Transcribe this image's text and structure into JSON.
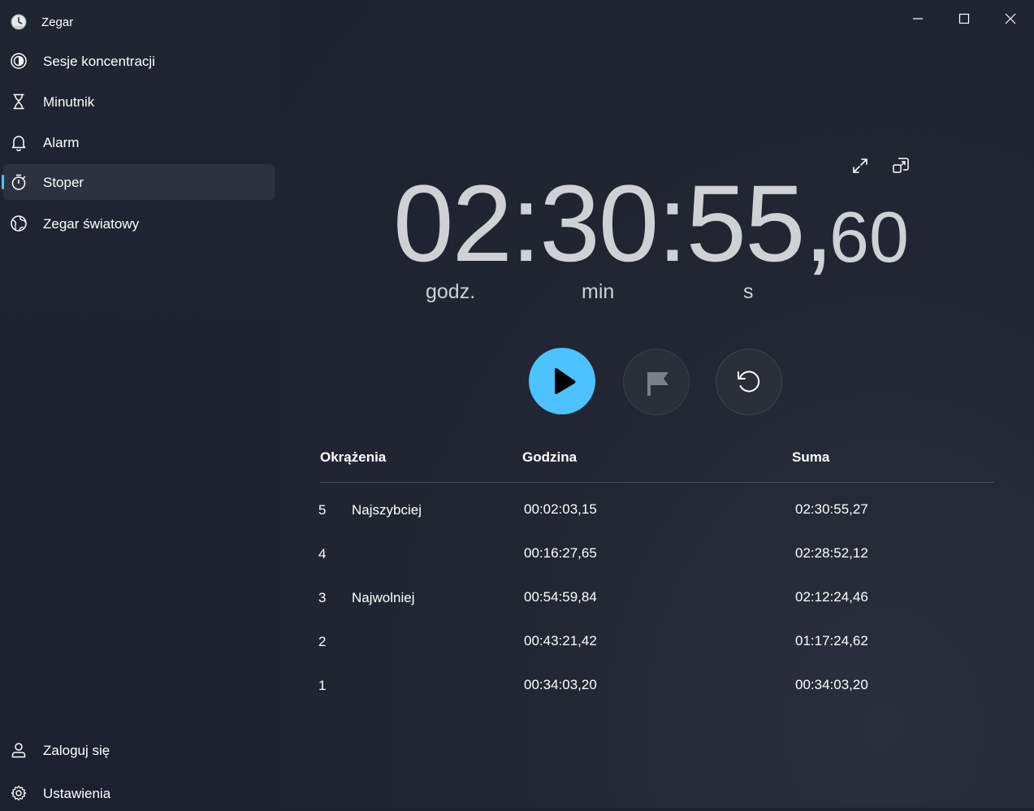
{
  "app": {
    "title": "Zegar"
  },
  "window_controls": {
    "minimize": "minimize-icon",
    "maximize": "maximize-icon",
    "close": "close-icon"
  },
  "sidebar": {
    "items": [
      {
        "label": "Sesje koncentracji",
        "icon": "focus-icon",
        "selected": false
      },
      {
        "label": "Minutnik",
        "icon": "hourglass-icon",
        "selected": false
      },
      {
        "label": "Alarm",
        "icon": "bell-icon",
        "selected": false
      },
      {
        "label": "Stoper",
        "icon": "stopwatch-icon",
        "selected": true
      },
      {
        "label": "Zegar światowy",
        "icon": "globe-icon",
        "selected": false
      }
    ],
    "footer": [
      {
        "label": "Zaloguj się",
        "icon": "person-icon"
      },
      {
        "label": "Ustawienia",
        "icon": "gear-icon"
      }
    ]
  },
  "stopwatch": {
    "time_main": "02:30:55,",
    "time_fraction": "60",
    "units": {
      "hours": "godz.",
      "minutes": "min",
      "seconds": "s"
    }
  },
  "laps": {
    "headers": {
      "lap": "Okrążenia",
      "time": "Godzina",
      "total": "Suma"
    },
    "rows": [
      {
        "number": "5",
        "tag": "Najszybciej",
        "lap_time": "00:02:03,15",
        "total": "02:30:55,27"
      },
      {
        "number": "4",
        "tag": "",
        "lap_time": "00:16:27,65",
        "total": "02:28:52,12"
      },
      {
        "number": "3",
        "tag": "Najwolniej",
        "lap_time": "00:54:59,84",
        "total": "02:12:24,46"
      },
      {
        "number": "2",
        "tag": "",
        "lap_time": "00:43:21,42",
        "total": "01:17:24,62"
      },
      {
        "number": "1",
        "tag": "",
        "lap_time": "00:34:03,20",
        "total": "00:34:03,20"
      }
    ]
  },
  "colors": {
    "accent": "#4cc2ff",
    "background": "#1e2230",
    "sidebar_selected": "#2d3240"
  }
}
